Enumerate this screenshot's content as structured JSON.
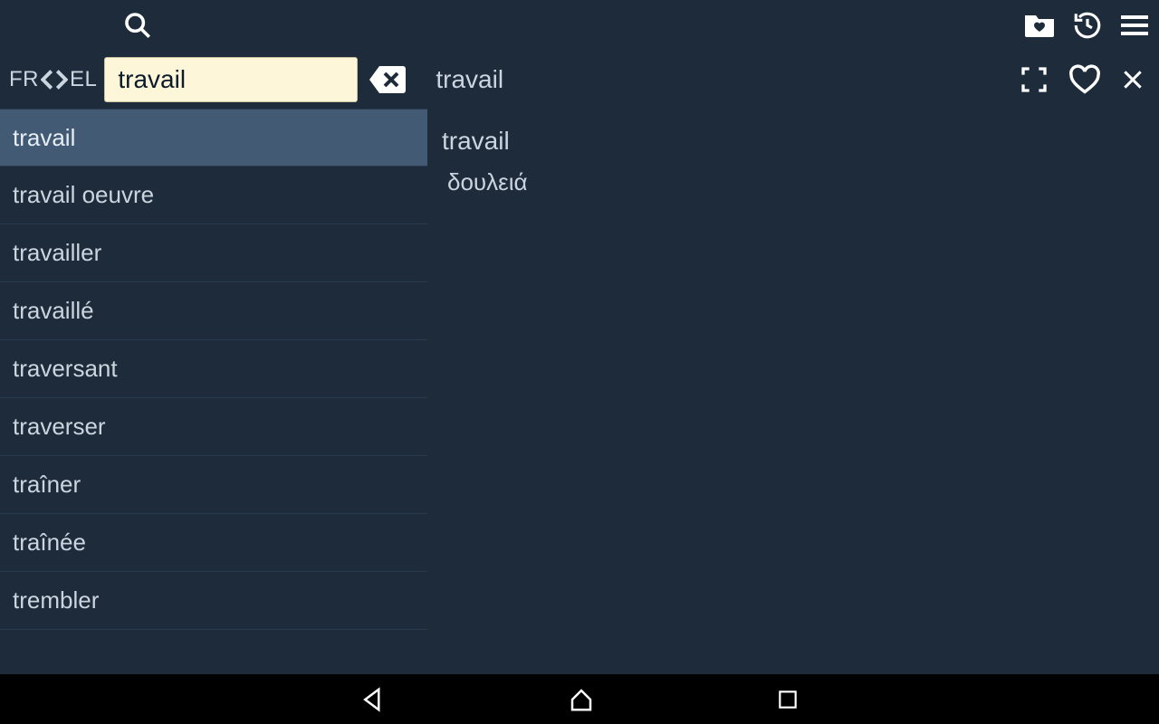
{
  "langs": {
    "from": "FR",
    "to": "EL"
  },
  "search": {
    "value": "travail"
  },
  "header_word": "travail",
  "words": [
    {
      "label": "travail",
      "selected": true
    },
    {
      "label": "travail oeuvre",
      "selected": false
    },
    {
      "label": "travailler",
      "selected": false
    },
    {
      "label": "travaillé",
      "selected": false
    },
    {
      "label": "traversant",
      "selected": false
    },
    {
      "label": "traverser",
      "selected": false
    },
    {
      "label": "traîner",
      "selected": false
    },
    {
      "label": "traînée",
      "selected": false
    },
    {
      "label": "trembler",
      "selected": false
    }
  ],
  "detail": {
    "word": "travail",
    "translation": "δουλειά"
  }
}
